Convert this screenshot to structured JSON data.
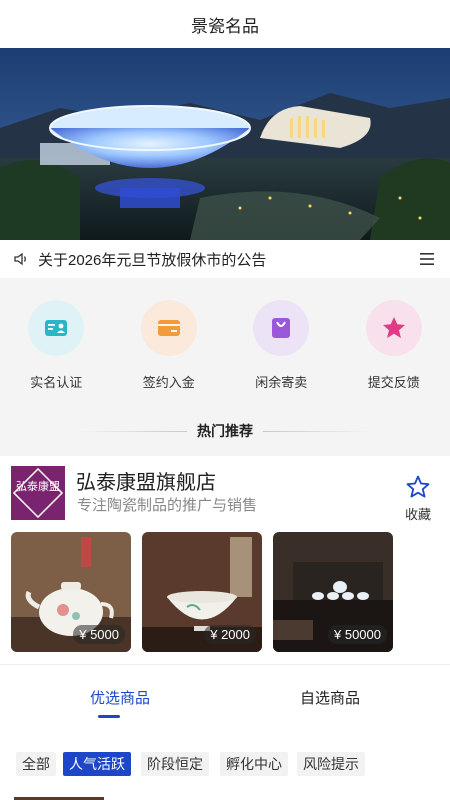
{
  "header": {
    "title": "景瓷名品"
  },
  "notice": {
    "text": "关于2026年元旦节放假休市的公告"
  },
  "quick": [
    {
      "label": "实名认证",
      "icon": "id-card-icon",
      "bg": "#dff3f6",
      "color": "#2bb6c8"
    },
    {
      "label": "签约入金",
      "icon": "card-icon",
      "bg": "#fbe9dc",
      "color": "#f39a3b"
    },
    {
      "label": "闲余寄卖",
      "icon": "shopping-bag-icon",
      "bg": "#ece3f6",
      "color": "#9b58d8"
    },
    {
      "label": "提交反馈",
      "icon": "star-icon",
      "bg": "#f8e1ec",
      "color": "#e23b85"
    }
  ],
  "hot": {
    "title": "热门推荐"
  },
  "shop": {
    "name": "弘泰康盟旗舰店",
    "desc": "专注陶瓷制品的推广与销售",
    "logo_text": "弘泰康盟",
    "fav_label": "收藏",
    "products": [
      {
        "price": "¥ 5000"
      },
      {
        "price": "¥ 2000"
      },
      {
        "price": "¥ 50000"
      }
    ]
  },
  "tabs": [
    "优选商品",
    "自选商品"
  ],
  "filters": [
    "全部",
    "人气活跃",
    "阶段恒定",
    "孵化中心",
    "风险提示"
  ],
  "colors": {
    "accent": "#1e46c8"
  }
}
